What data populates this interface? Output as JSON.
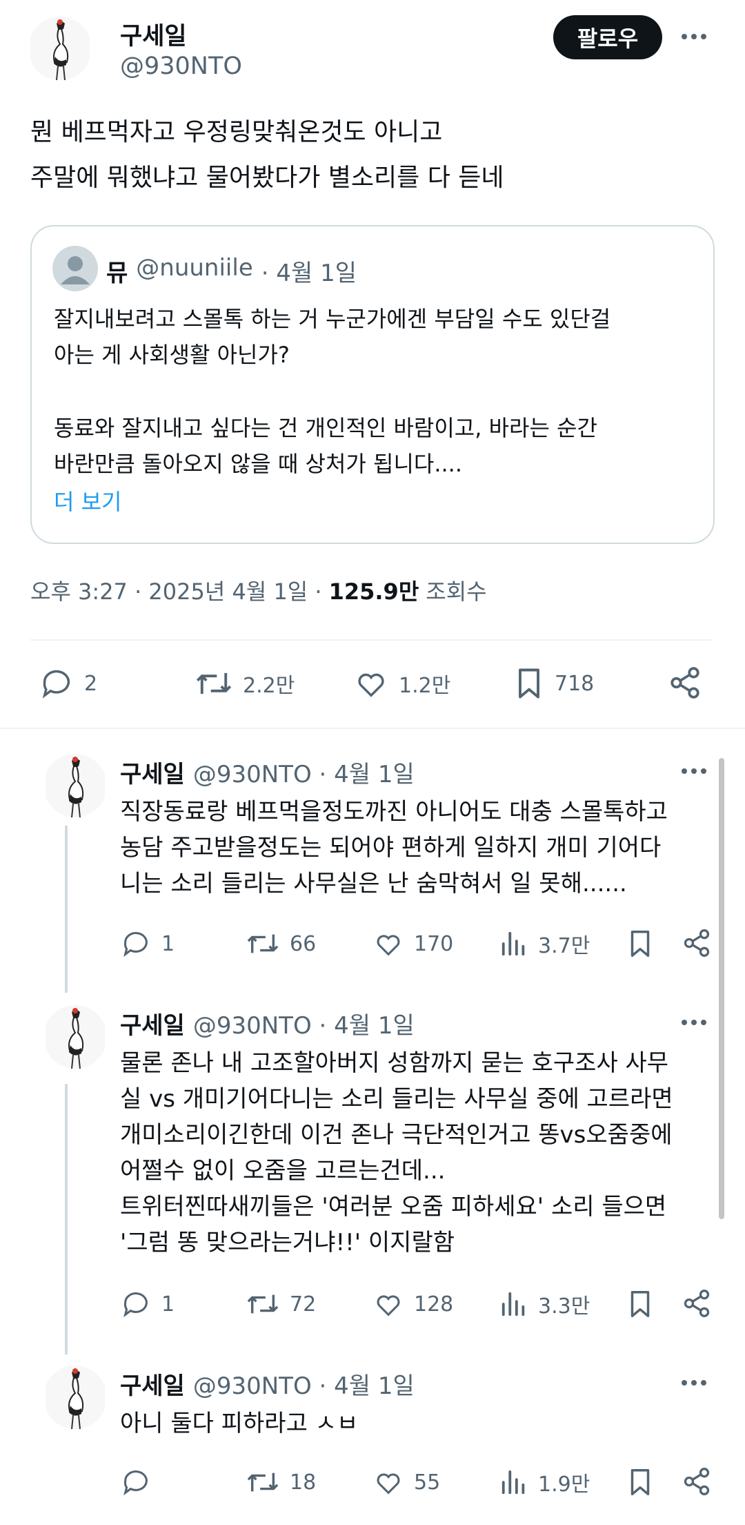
{
  "main_tweet": {
    "author_name": "구세일",
    "author_handle": "@930NTO",
    "follow_label": "팔로우",
    "text_line1": "뭔 베프먹자고 우정링맞춰온것도 아니고",
    "text_line2": "주말에 뭐했냐고 물어봤다가 별소리를 다 듣네",
    "quote": {
      "author_name": "뮤",
      "author_handle": "@nuuniile",
      "date": "· 4월 1일",
      "line1": "잘지내보려고 스몰톡 하는 거 누군가에겐 부담일 수도 있단걸",
      "line2": "아는 게 사회생활 아닌가?",
      "line3": "동료와 잘지내고 싶다는 건 개인적인 바람이고, 바라는 순간",
      "line4": "바란만큼 돌아오지 않을 때 상처가 됩니다....",
      "show_more": "더 보기"
    },
    "meta_time": "오후 3:27 · 2025년 4월 1일 ·",
    "meta_views": "125.9만",
    "meta_views_label": "조회수",
    "stats": {
      "replies": "2",
      "retweets": "2.2만",
      "likes": "1.2만",
      "bookmarks": "718"
    }
  },
  "replies": [
    {
      "author_name": "구세일",
      "handle_date": "@930NTO · 4월 1일",
      "lines": [
        "직장동료랑 베프먹을정도까진 아니어도 대충 스몰톡하고",
        "농담 주고받을정도는 되어야 편하게 일하지 개미 기어다",
        "니는 소리 들리는 사무실은 난 숨막혀서 일 못해......"
      ],
      "replies": "1",
      "retweets": "66",
      "likes": "170",
      "views": "3.7만"
    },
    {
      "author_name": "구세일",
      "handle_date": "@930NTO · 4월 1일",
      "lines": [
        "물론 존나 내 고조할아버지 성함까지 묻는 호구조사 사무",
        "실 vs 개미기어다니는 소리 들리는 사무실 중에 고르라면",
        "개미소리이긴한데 이건 존나 극단적인거고 똥vs오줌중에",
        "어쩔수 없이 오줌을 고르는건데...",
        "트위터찐따새끼들은 '여러분 오줌 피하세요' 소리 들으면",
        "'그럼 똥 맞으라는거냐!!' 이지랄함"
      ],
      "replies": "1",
      "retweets": "72",
      "likes": "128",
      "views": "3.3만"
    },
    {
      "author_name": "구세일",
      "handle_date": "@930NTO · 4월 1일",
      "lines": [
        "아니 둘다 피하라고 ㅅㅂ"
      ],
      "replies": "",
      "retweets": "18",
      "likes": "55",
      "views": "1.9만"
    }
  ],
  "colors": {
    "link": "#1d9bf0",
    "muted": "#536471",
    "text": "#0f1419",
    "border": "#cfd9de"
  }
}
